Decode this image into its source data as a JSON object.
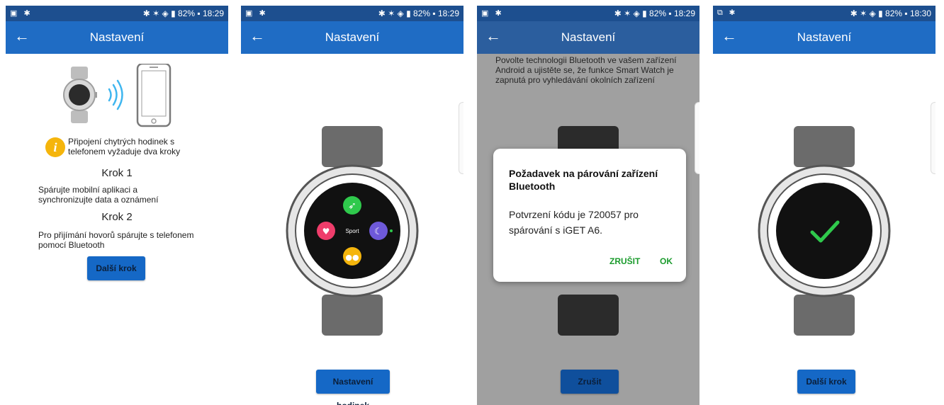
{
  "status": {
    "s1": {
      "left": "▣ ✱",
      "right": "✱ ✶ ◈ ▮ 82% ▪ 18:29"
    },
    "s2": {
      "left": "▣ ✱",
      "right": "✱ ✶ ◈ ▮ 82% ▪ 18:29"
    },
    "s3": {
      "left": "▣ ✱",
      "right": "✱ ✶ ◈ ▮ 82% ▪ 18:29"
    },
    "s4": {
      "left": "⧉ ✱",
      "right": "✱ ✶ ◈ ▮ 82% ▪ 18:30"
    }
  },
  "appbar": {
    "title": "Nastavení",
    "back": "←"
  },
  "screen1": {
    "info": "Připojení chytrých hodinek s telefonem vyžaduje dva kroky",
    "step1_title": "Krok 1",
    "step1_text": "Spárujte mobilní aplikaci a synchronizujte data a oznámení",
    "step2_title": "Krok 2",
    "step2_text": "Pro přijímání hovorů spárujte s telefonem pomocí Bluetooth",
    "button": "Další krok"
  },
  "screen2": {
    "button": "Nastavení hodinek",
    "watch_center_label": "Sport"
  },
  "screen3": {
    "top_text": "Povolte technologii Bluetooth ve vašem zařízení Android a ujistěte se, že funkce Smart Watch je zapnutá pro vyhledávání okolních zařízení",
    "dialog_title": "Požadavek na párování zařízení Bluetooth",
    "dialog_body": "Potvrzení kódu je 720057 pro spárování s iGET A6.",
    "cancel": "ZRUŠIT",
    "ok": "OK",
    "button": "Zrušit"
  },
  "screen4": {
    "button": "Další krok"
  },
  "colors": {
    "statusbar": "#1d4f8f",
    "appbar": "#1f6cc4",
    "button": "#1568c6",
    "dialog_action": "#1a9b2c",
    "check": "#2fc94c"
  }
}
